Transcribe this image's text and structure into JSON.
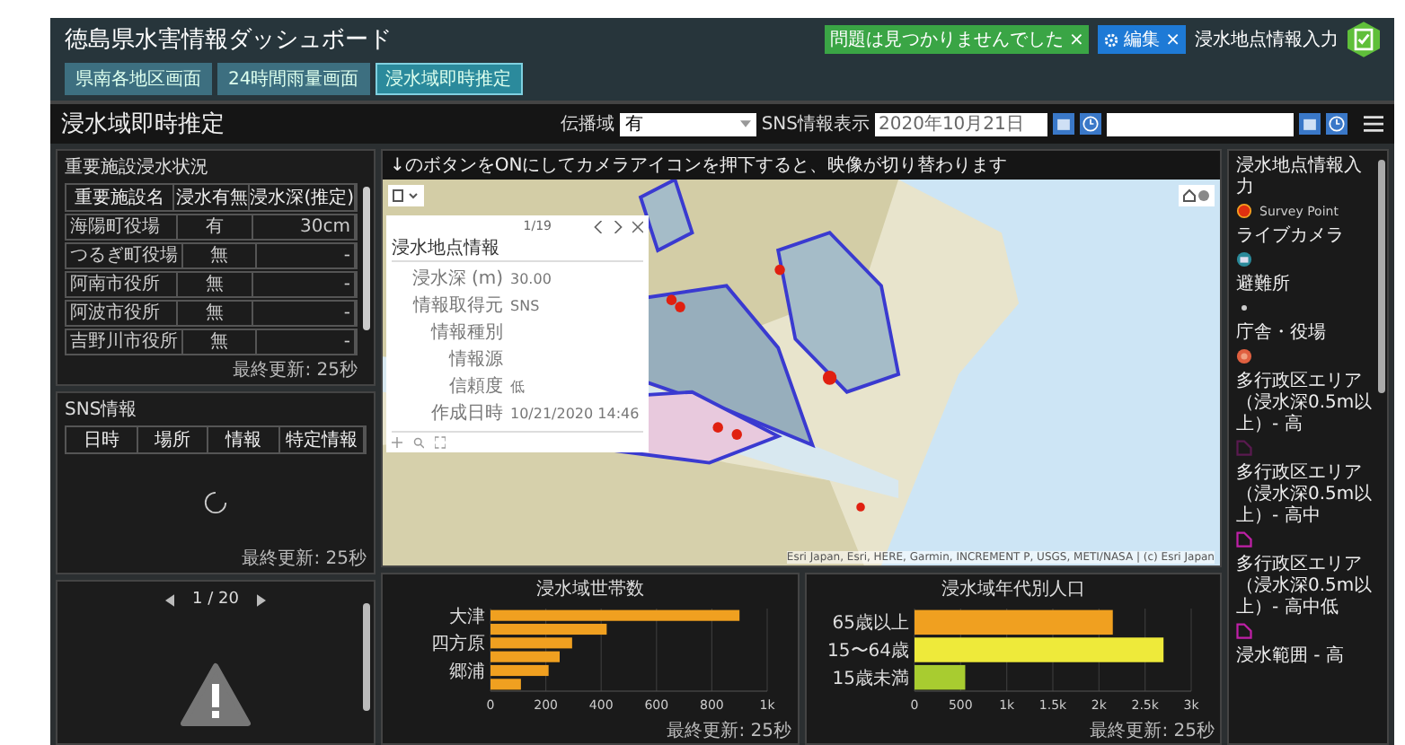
{
  "header": {
    "title": "徳島県水害情報ダッシュボード",
    "status_badge": "問題は見つかりませんでした ×",
    "edit_badge": "編集 ×",
    "input_link": "浸水地点情報入力"
  },
  "tabs": [
    {
      "label": "県南各地区画面",
      "selected": false
    },
    {
      "label": "24時間雨量画面",
      "selected": false
    },
    {
      "label": "浸水域即時推定",
      "selected": true
    }
  ],
  "toolbar": {
    "title": "浸水域即時推定",
    "spread_label": "伝播域",
    "spread_value": "有",
    "sns_label": "SNS情報表示",
    "date_value": "2020年10月21日"
  },
  "facilities": {
    "title": "重要施設浸水状況",
    "columns": [
      "重要施設名",
      "浸水有無",
      "浸水深(推定)"
    ],
    "rows": [
      [
        "海陽町役場",
        "有",
        "30cm"
      ],
      [
        "つるぎ町役場",
        "無",
        "-"
      ],
      [
        "阿南市役所",
        "無",
        "-"
      ],
      [
        "阿波市役所",
        "無",
        "-"
      ],
      [
        "吉野川市役所",
        "無",
        "-"
      ]
    ],
    "footer": "最終更新: 25秒"
  },
  "sns": {
    "title": "SNS情報",
    "columns": [
      "日時",
      "場所",
      "情報",
      "特定情報"
    ],
    "loading": true,
    "footer": "最終更新: 25秒"
  },
  "camera": {
    "pager": "1 / 20"
  },
  "map": {
    "notice": "↓のボタンをONにしてカメラアイコンを押下すると、映像が切り替わります",
    "popup": {
      "pager": "1/19",
      "title": "浸水地点情報",
      "fields": [
        {
          "label": "浸水深 (m)",
          "value": "30.00"
        },
        {
          "label": "情報取得元",
          "value": "SNS"
        },
        {
          "label": "情報種別"
        },
        {
          "label": "情報源"
        },
        {
          "label": "信頼度",
          "value": "低"
        },
        {
          "label": "作成日時",
          "value": "10/21/2020 14:46"
        }
      ]
    },
    "attribution": "Esri Japan, Esri, HERE, Garmin, INCREMENT P, USGS, METI/NASA | (c) Esri Japan"
  },
  "charts": [
    {
      "footer": "最終更新: 25秒",
      "chart_data": {
        "type": "bar",
        "orientation": "horizontal",
        "grid": true,
        "title": "浸水域世帯数",
        "categories": [
          "大津",
          null,
          "四方原",
          null,
          "郷浦",
          null
        ],
        "values": [
          900,
          420,
          295,
          250,
          210,
          110
        ],
        "colors": [
          "#f0a020",
          "#f0a020",
          "#f0a020",
          "#f0a020",
          "#f0a020",
          "#f0a020"
        ],
        "xlim": [
          0,
          1000
        ],
        "xticks": [
          0,
          200,
          400,
          600,
          800,
          {
            "value": 1000,
            "label": "1k"
          }
        ]
      }
    },
    {
      "footer": "最終更新: 25秒",
      "chart_data": {
        "type": "bar",
        "orientation": "horizontal",
        "grid": true,
        "title": "浸水域年代別人口",
        "categories": [
          "65歳以上",
          "15〜64歳",
          "15歳未満"
        ],
        "values": [
          2150,
          2700,
          550
        ],
        "colors": [
          "#f0a020",
          "#eeea3a",
          "#a8cc30"
        ],
        "xlim": [
          0,
          3000
        ],
        "xticks": [
          0,
          500,
          {
            "value": 1000,
            "label": "1k"
          },
          {
            "value": 1500,
            "label": "1.5k"
          },
          {
            "value": 2000,
            "label": "2k"
          },
          {
            "value": 2500,
            "label": "2.5k"
          },
          {
            "value": 3000,
            "label": "3k"
          }
        ]
      }
    }
  ],
  "legend": [
    {
      "label": "浸水地点情報入力",
      "kind": "point",
      "symbol_label": "Survey Point"
    },
    {
      "label": "ライブカメラ",
      "kind": "camera"
    },
    {
      "label": "避難所",
      "kind": "dot"
    },
    {
      "label": "庁舎・役場",
      "kind": "circle"
    },
    {
      "label": "多行政区エリア（浸水深0.5m以上）- 高",
      "kind": "polygon",
      "color": "#5a1a50"
    },
    {
      "label": "多行政区エリア（浸水深0.5m以上）- 高中",
      "kind": "polygon",
      "color": "#c020a8"
    },
    {
      "label": "多行政区エリア（浸水深0.5m以上）- 高中低",
      "kind": "polygon",
      "color": "#c020a8"
    },
    {
      "label": "浸水範囲 - 高"
    }
  ]
}
